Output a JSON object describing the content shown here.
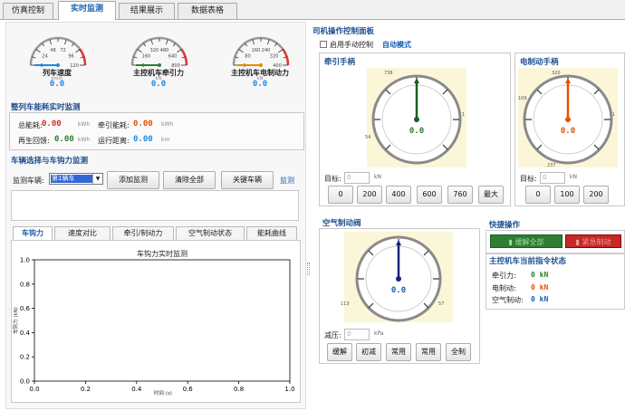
{
  "tabs": [
    {
      "label": "仿真控制"
    },
    {
      "label": "实时监测"
    },
    {
      "label": "结果展示"
    },
    {
      "label": "数据表格"
    }
  ],
  "gauges": [
    {
      "label": "列车速度",
      "unit": "km/h",
      "value": "0.0",
      "ticks": [
        "0",
        "24",
        "48",
        "72",
        "96",
        "120"
      ],
      "color": "#1e88e5"
    },
    {
      "label": "主控机车牵引力",
      "unit": "kN",
      "value": "0.0",
      "ticks": [
        "0",
        "160",
        "320",
        "480",
        "640",
        "800"
      ],
      "color": "#2e7d32"
    },
    {
      "label": "主控机车电制动力",
      "unit": "kN",
      "value": "0.0",
      "ticks": [
        "0",
        "80",
        "160",
        "240",
        "320",
        "400"
      ],
      "color": "#e68a00"
    }
  ],
  "energy": {
    "title": "整列车能耗实时监测",
    "total_label": "总能耗:",
    "total_value": "0.00",
    "total_unit": "kWh",
    "traction_label": "牵引能耗:",
    "traction_value": "0.00",
    "traction_unit": "kWh",
    "regen_label": "再生回馈:",
    "regen_value": "0.00",
    "regen_unit": "kWh",
    "distance_label": "运行距离:",
    "distance_value": "0.00",
    "distance_unit": "km"
  },
  "coupler": {
    "title": "车辆选择与车钩力监测",
    "vehicle_label": "监测车辆:",
    "vehicle_selected": "第1辆车",
    "add_btn": "添加监测",
    "clear_btn": "清除全部",
    "key_btn": "关键车辆",
    "monitor_link": "监测"
  },
  "chart_tabs": [
    {
      "label": "车钩力"
    },
    {
      "label": "速度对比"
    },
    {
      "label": "牵引/制动力"
    },
    {
      "label": "空气制动状态"
    },
    {
      "label": "能耗曲线"
    }
  ],
  "chart_data": {
    "type": "line",
    "title": "车钩力实时监测",
    "xlabel": "时间 (s)",
    "ylabel": "车钩力 (kN)",
    "xlim": [
      0,
      1
    ],
    "ylim": [
      0,
      1
    ],
    "x_ticks": [
      "0.0",
      "0.2",
      "0.4",
      "0.6",
      "0.8",
      "1.0"
    ],
    "y_ticks": [
      "0.0",
      "0.2",
      "0.4",
      "0.6",
      "0.8",
      "1.0"
    ],
    "series": []
  },
  "driver": {
    "title": "司机操作控制面板",
    "manual_label": "启用手动控制",
    "auto_label": "自动模式",
    "traction": {
      "title": "牵引手柄",
      "value": "0.0",
      "top": "738",
      "left": "54",
      "right": "1",
      "target_label": "目标:",
      "target_placeholder": "0",
      "target_unit": "kN",
      "presets": [
        "0",
        "200",
        "400",
        "600",
        "760",
        "最大"
      ]
    },
    "ebrake": {
      "title": "电制动手柄",
      "value": "0.0",
      "top": "320",
      "left": "109",
      "right": "1",
      "bottom": "237",
      "target_label": "目标:",
      "target_placeholder": "0",
      "target_unit": "kN",
      "presets": [
        "0",
        "100",
        "200"
      ]
    },
    "airbrake": {
      "title": "空气制动阀",
      "value": "0.0",
      "left": "113",
      "right": "57",
      "reduce_label": "减压:",
      "reduce_placeholder": "0",
      "reduce_unit": "kPa",
      "presets": [
        "缓解",
        "初减",
        "常用",
        "常用",
        "全制"
      ]
    },
    "quick": {
      "title": "快捷操作",
      "release": "▮ 缓解全部",
      "emergency": "▮ 紧急制动"
    },
    "status": {
      "title": "主控机车当前指令状态",
      "traction_label": "牵引力:",
      "traction_value": "0 kN",
      "ebrake_label": "电制动:",
      "ebrake_value": "0 kN",
      "air_label": "空气制动:",
      "air_value": "0 kN"
    }
  }
}
